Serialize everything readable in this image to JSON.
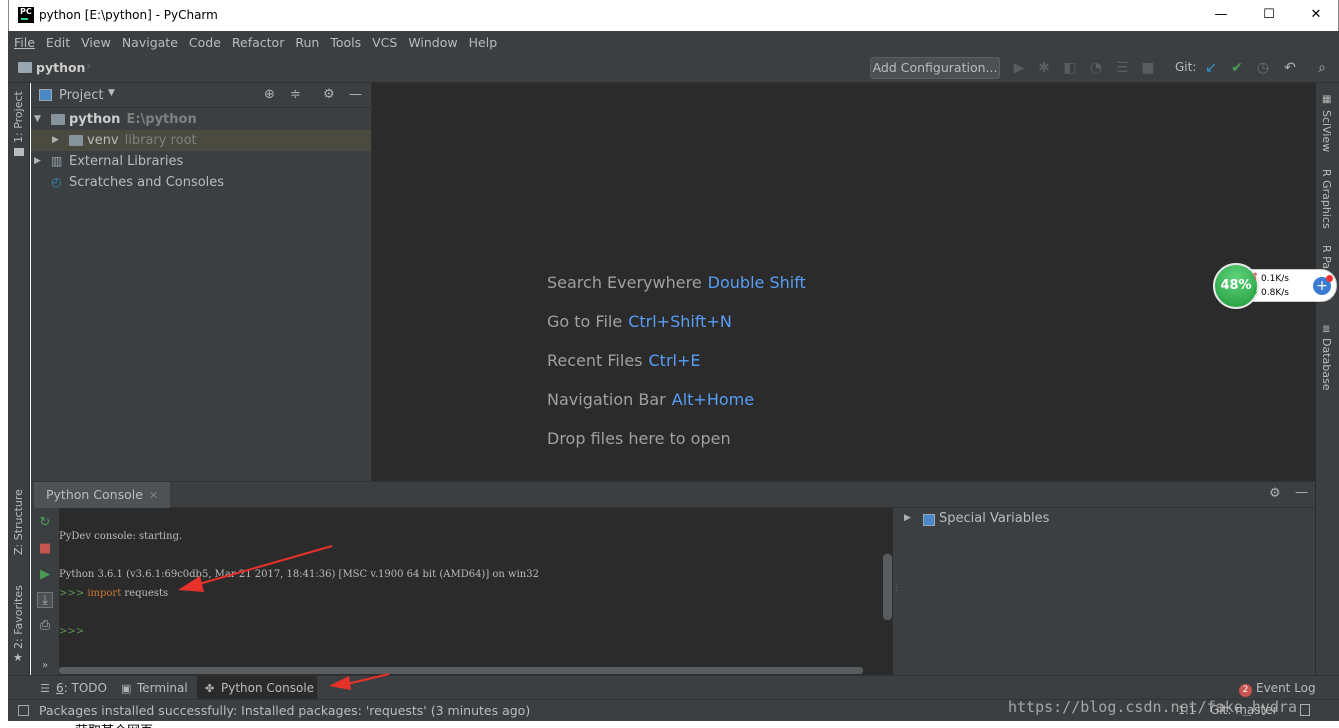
{
  "window": {
    "title": "python [E:\\python] - PyCharm",
    "app_icon_text": "PC",
    "minimize": "—",
    "maximize": "☐",
    "close": "✕"
  },
  "menu": [
    "File",
    "Edit",
    "View",
    "Navigate",
    "Code",
    "Refactor",
    "Run",
    "Tools",
    "VCS",
    "Window",
    "Help"
  ],
  "navbar": {
    "breadcrumb": "python",
    "add_configuration": "Add Configuration...",
    "git_label": "Git:"
  },
  "left_strip": {
    "project_tab": "1: Project",
    "structure_tab": "Z: Structure",
    "favorites_tab": "2: Favorites"
  },
  "right_strip": {
    "sciview": "SciView",
    "r_graphics": "R Graphics",
    "r_packages": "R Pa",
    "database": "Database"
  },
  "project": {
    "header": "Project",
    "tree": [
      {
        "name": "python",
        "path": "E:\\python"
      },
      {
        "name": "venv",
        "path": "library root"
      },
      {
        "name": "External Libraries",
        "path": ""
      },
      {
        "name": "Scratches and Consoles",
        "path": ""
      }
    ]
  },
  "editor": {
    "hints": [
      {
        "label": "Search Everywhere",
        "key": "Double Shift"
      },
      {
        "label": "Go to File",
        "key": "Ctrl+Shift+N"
      },
      {
        "label": "Recent Files",
        "key": "Ctrl+E"
      },
      {
        "label": "Navigation Bar",
        "key": "Alt+Home"
      },
      {
        "label": "Drop files here to open",
        "key": ""
      }
    ]
  },
  "console": {
    "tab": "Python Console",
    "lines": {
      "starting": "PyDev console: starting.",
      "version": "Python 3.6.1 (v3.6.1:69c0db5, Mar 21 2017, 18:41:36) [MSC v.1900 64 bit (AMD64)] on win32",
      "prompt": ">>>",
      "import_kw": "import",
      "import_rest": " requests",
      "prompt2": ">>>"
    },
    "special_variables": "Special Variables"
  },
  "bottom_tabs": {
    "todo_num": "6",
    "todo": ": TODO",
    "terminal": "Terminal",
    "python_console": "Python Console",
    "event_log_count": "2",
    "event_log": "Event Log"
  },
  "status": {
    "message": "Packages installed successfully: Installed packages: 'requests' (3 minutes ago)",
    "position": "1:1",
    "git": "Git: master"
  },
  "netmeter": {
    "percent": "48%",
    "upload": "0.1K/s",
    "download": "0.8K/s"
  },
  "watermark": "https://blog.csdn.net/fake_hydra",
  "below_text": "获取某个网页:",
  "colors": {
    "background": "#2b2b2b",
    "panel": "#3c3f41",
    "accent_key": "#589df6",
    "keyword": "#cc7832",
    "prompt": "#629755",
    "run_green": "#499c54",
    "stop_red": "#c75450",
    "arrow_red": "#e8312a"
  }
}
